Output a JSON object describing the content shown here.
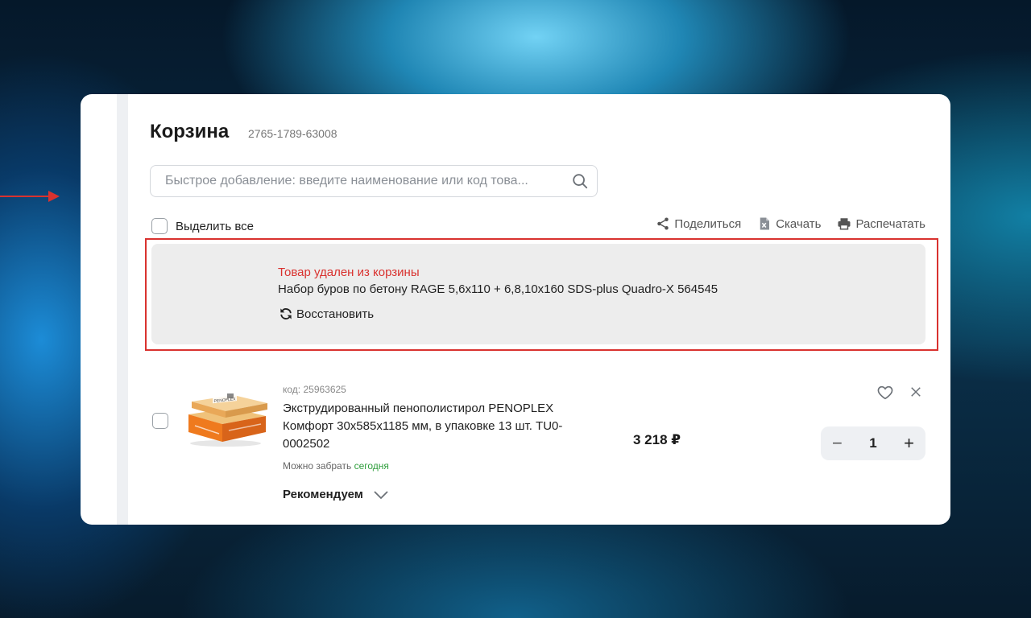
{
  "cart": {
    "title": "Корзина",
    "order_number": "2765-1789-63008"
  },
  "search": {
    "placeholder": "Быстрое добавление: введите наименование или код това..."
  },
  "toolbar": {
    "select_all_label": "Выделить все",
    "share_label": "Поделиться",
    "download_label": "Скачать",
    "print_label": "Распечатать"
  },
  "removed_notice": {
    "title": "Товар удален из корзины",
    "product_name": "Набор буров по бетону RAGE 5,6x110 + 6,8,10x160 SDS-plus Quadro-X 564545",
    "restore_label": "Восстановить"
  },
  "items": [
    {
      "code": "код: 25963625",
      "name": "Экструдированный пенополистирол PENOPLEX Комфорт 30x585x1185 мм, в упаковке 13 шт. TU0-0002502",
      "pickup_prefix": "Можно забрать",
      "pickup_when": "сегодня",
      "price": "3 218 ₽",
      "quantity": "1",
      "minus": "−",
      "plus": "+",
      "recommend_label": "Рекомендуем"
    }
  ],
  "colors": {
    "accent_red": "#d9322f",
    "pickup_green": "#2e9e3c"
  }
}
